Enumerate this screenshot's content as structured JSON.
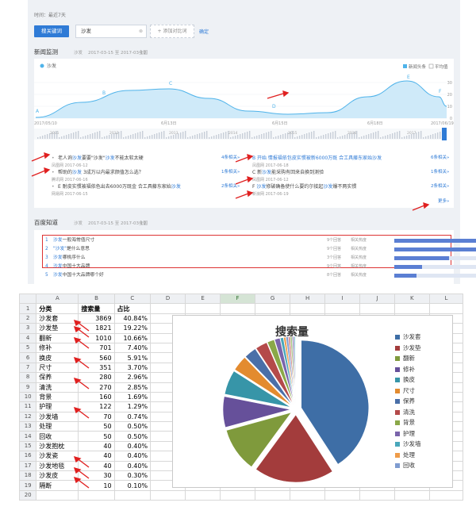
{
  "top": {
    "time_filter": "时间：最近7天",
    "compare_button": "搜关键词",
    "keyword_value": "沙发",
    "clear_glyph": "⊗",
    "add_button": "+ 添加对比词",
    "confirm_link": "确定",
    "news_section": {
      "title": "新闻监测",
      "keyword": "沙发",
      "date_range": "2017-03-15 至 2017-03-19",
      "scope": "全国"
    },
    "chart": {
      "legend_label": "沙发",
      "right_options": [
        "新闻头条",
        "平均值"
      ],
      "y_ticks": [
        "30",
        "20",
        "10",
        "0"
      ],
      "x_ticks": [
        "2017/05/10",
        "6月13日",
        "6月15日",
        "6月18日",
        "2017/06/19"
      ],
      "mini_years": [
        "2011",
        "2012",
        "2013",
        "2014",
        "2015",
        "2016",
        "2017"
      ],
      "point_labels": [
        "A",
        "B",
        "C",
        "D",
        "E",
        "F"
      ],
      "series_color": "#4fb3ea"
    },
    "news_left": [
      {
        "pre": "老人询",
        "kw": "沙发",
        "post": "要要\"沙发\"",
        "kw2": "沙发",
        "post2": "不能太软太硬",
        "src": "凤凰网 2017-06-12",
        "rel": "4条相关»"
      },
      {
        "pre": "帮助的",
        "kw": "沙发",
        "post": " 3成万以内最求颜值怎么选？",
        "kw2": "",
        "post2": "",
        "src": "腾讯网 2017-06-16",
        "rel": "1条相关»"
      },
      {
        "pre": "E 耐皮实惯被福依色出去6000万既金 合工具藤东家始",
        "kw": "沙发",
        "post": "",
        "kw2": "",
        "post2": "",
        "src": "网易网 2017-06-15",
        "rel": "2条相关»"
      }
    ],
    "news_right": [
      {
        "pre": "B 开始 情报福依包皮实惯被新6000万既 合工具藤东家始",
        "kw": "沙发",
        "post": "",
        "src": "凤凰网 2017-06-18",
        "rel": "6条相关»"
      },
      {
        "pre": "C 新",
        "kw": "沙发",
        "post": "能采购有回来自换到测验",
        "src": "凤凰网 2017-06-12",
        "rel": "1条相关»"
      },
      {
        "pre": "F ",
        "kw": "沙发",
        "post": "修破确备使什么要约尔接起",
        "kw2": "沙发",
        "post2": "爆不两实惯",
        "src": "新浪网 2017-06-19",
        "rel": "2条相关»"
      }
    ],
    "more_link": "更多»",
    "zhidao_section": {
      "title": "百度知道",
      "keyword": "沙发",
      "date_range": "2017-03-15 至 2017-03-19",
      "scope": "全国"
    },
    "questions": [
      {
        "n": "1",
        "kw": "沙发",
        "text": "一般海常值尺寸",
        "answers": "9个回答",
        "tag": "相关热度",
        "pct": 1.0
      },
      {
        "n": "2",
        "kw": "\"沙发\"",
        "text": "是什么意思",
        "answers": "9个回答",
        "tag": "相关热度",
        "pct": 0.85
      },
      {
        "n": "3",
        "kw": "沙发",
        "text": "哪桃序什么",
        "answers": "3个回答",
        "tag": "相关热度",
        "pct": 0.55
      },
      {
        "n": "4",
        "kw": "沙发",
        "text": "中国十大品牌",
        "answers": "9个回答",
        "tag": "相关热度",
        "pct": 0.28
      },
      {
        "n": "5",
        "kw": "沙发",
        "text": "中国十大品牌哪个好",
        "answers": "8个回答",
        "tag": "相关热度",
        "pct": 0.22
      }
    ]
  },
  "sheet": {
    "columns": [
      "A",
      "B",
      "C",
      "D",
      "E",
      "F",
      "G",
      "H",
      "I",
      "J",
      "K",
      "L"
    ],
    "selected_column": "F",
    "headers": [
      "分类",
      "搜索量",
      "占比"
    ],
    "rows": [
      [
        "沙发套",
        "3869",
        "40.84%"
      ],
      [
        "沙发垫",
        "1821",
        "19.22%"
      ],
      [
        "翻新",
        "1010",
        "10.66%"
      ],
      [
        "修补",
        "701",
        "7.40%"
      ],
      [
        "换皮",
        "560",
        "5.91%"
      ],
      [
        "尺寸",
        "351",
        "3.70%"
      ],
      [
        "保养",
        "280",
        "2.96%"
      ],
      [
        "清洗",
        "270",
        "2.85%"
      ],
      [
        "背景",
        "160",
        "1.69%"
      ],
      [
        "护理",
        "122",
        "1.29%"
      ],
      [
        "沙发墙",
        "70",
        "0.74%"
      ],
      [
        "处理",
        "50",
        "0.50%"
      ],
      [
        "回收",
        "50",
        "0.50%"
      ],
      [
        "沙发抱枕",
        "40",
        "0.40%"
      ],
      [
        "沙发瓷",
        "40",
        "0.40%"
      ],
      [
        "沙发地毯",
        "40",
        "0.40%"
      ],
      [
        "沙发皮",
        "30",
        "0.30%"
      ],
      [
        "隔断",
        "10",
        "0.10%"
      ]
    ]
  },
  "chart_data": {
    "type": "pie",
    "title": "搜索量",
    "categories": [
      "沙发套",
      "沙发垫",
      "翻新",
      "修补",
      "换皮",
      "尺寸",
      "保养",
      "清洗",
      "背景",
      "护理",
      "沙发墙",
      "处理",
      "回收",
      "沙发抱枕",
      "沙发瓷",
      "沙发地毯",
      "沙发皮",
      "隔断"
    ],
    "values": [
      3869,
      1821,
      1010,
      701,
      560,
      351,
      280,
      270,
      160,
      122,
      70,
      50,
      50,
      40,
      40,
      40,
      30,
      10
    ],
    "legend": [
      "沙发套",
      "沙发垫",
      "翻新",
      "修补",
      "换皮",
      "尺寸",
      "保养",
      "清洗",
      "背景",
      "护理",
      "沙发墙",
      "处理",
      "回收"
    ],
    "legend_placement": "right",
    "colors": [
      "#3e6ea6",
      "#a33c3c",
      "#7f9a3c",
      "#66509a",
      "#3795a8",
      "#e38b2f",
      "#4a6fa8",
      "#b44a4a",
      "#8aa848",
      "#7a64ab",
      "#49a7bb",
      "#ef9c4a",
      "#7f9cd0",
      "#d07f7f",
      "#a8c27f",
      "#9c8fc2",
      "#7fc2d0",
      "#f2b97f"
    ]
  }
}
